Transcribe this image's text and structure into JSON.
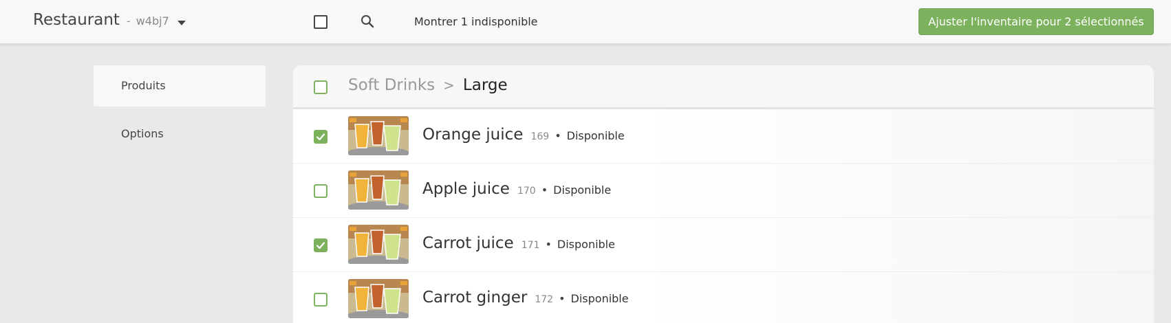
{
  "header": {
    "restaurant_name": "Restaurant",
    "separator": "-",
    "restaurant_code": "w4bj7",
    "show_unavailable": "Montrer 1 indisponible",
    "adjust_button": "Ajuster l'inventaire pour 2 sélectionnés"
  },
  "sidebar": {
    "items": [
      {
        "label": "Produits"
      },
      {
        "label": "Options"
      }
    ]
  },
  "breadcrumb": {
    "parent": "Soft Drinks",
    "separator": ">",
    "current": "Large"
  },
  "products": [
    {
      "name": "Orange juice",
      "id": "169",
      "dot": "•",
      "status": "Disponible",
      "checked": true
    },
    {
      "name": "Apple juice",
      "id": "170",
      "dot": "•",
      "status": "Disponible",
      "checked": false
    },
    {
      "name": "Carrot juice",
      "id": "171",
      "dot": "•",
      "status": "Disponible",
      "checked": true
    },
    {
      "name": "Carrot ginger",
      "id": "172",
      "dot": "•",
      "status": "Disponible",
      "checked": false
    }
  ],
  "colors": {
    "accent": "#7cb15d",
    "background": "#e9e9e9"
  }
}
